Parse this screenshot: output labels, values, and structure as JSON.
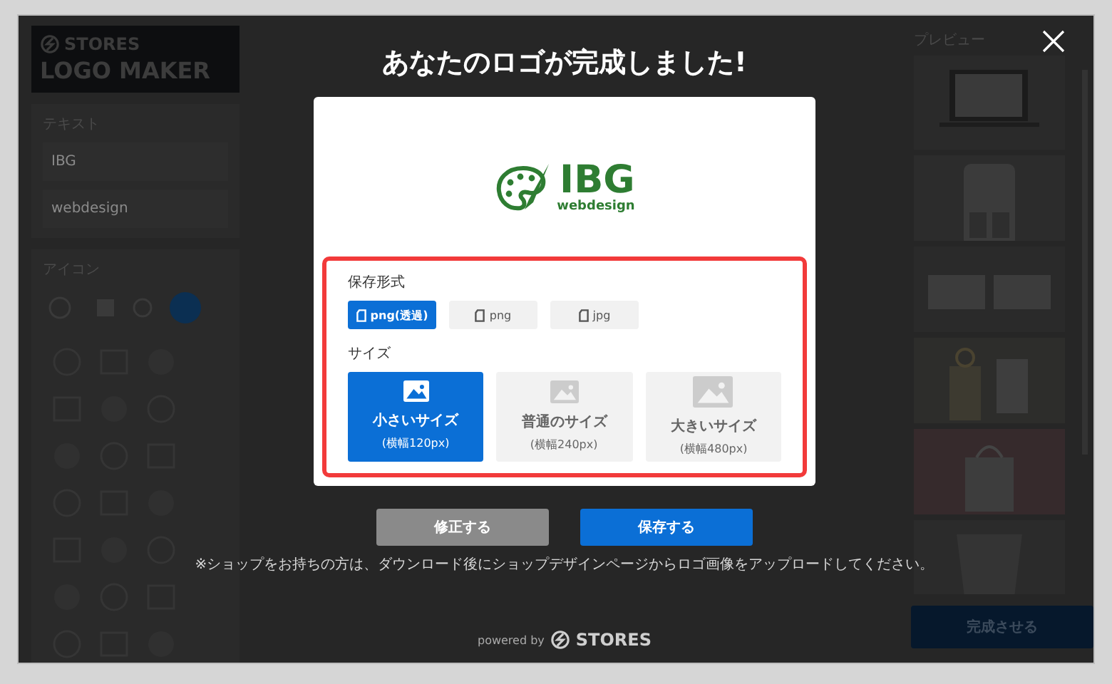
{
  "title": "あなたのロゴが完成しました!",
  "sidebar": {
    "brand": "STORES",
    "product": "LOGO MAKER",
    "text_section": {
      "label": "テキスト",
      "fields": [
        "IBG",
        "webdesign"
      ]
    },
    "icon_section": {
      "label": "アイコン"
    }
  },
  "preview": {
    "label": "プレビュー",
    "complete_button": "完成させる"
  },
  "dialog": {
    "logo": {
      "name": "IBG",
      "tagline": "webdesign"
    },
    "format_label": "保存形式",
    "formats": [
      {
        "label": "png(透過)",
        "selected": true
      },
      {
        "label": "png",
        "selected": false
      },
      {
        "label": "jpg",
        "selected": false
      }
    ],
    "size_label": "サイズ",
    "sizes": [
      {
        "name": "小さいサイズ",
        "detail": "(横幅120px)",
        "selected": true
      },
      {
        "name": "普通のサイズ",
        "detail": "(横幅240px)",
        "selected": false
      },
      {
        "name": "大きいサイズ",
        "detail": "(横幅480px)",
        "selected": false
      }
    ]
  },
  "buttons": [
    {
      "label": "修正する",
      "kind": "secondary"
    },
    {
      "label": "保存する",
      "kind": "primary"
    }
  ],
  "note": "※ショップをお持ちの方は、ダウンロード後にショップデザインページからロゴ画像をアップロードしてください。",
  "footer": {
    "powered_by": "powered by",
    "brand": "STORES"
  }
}
